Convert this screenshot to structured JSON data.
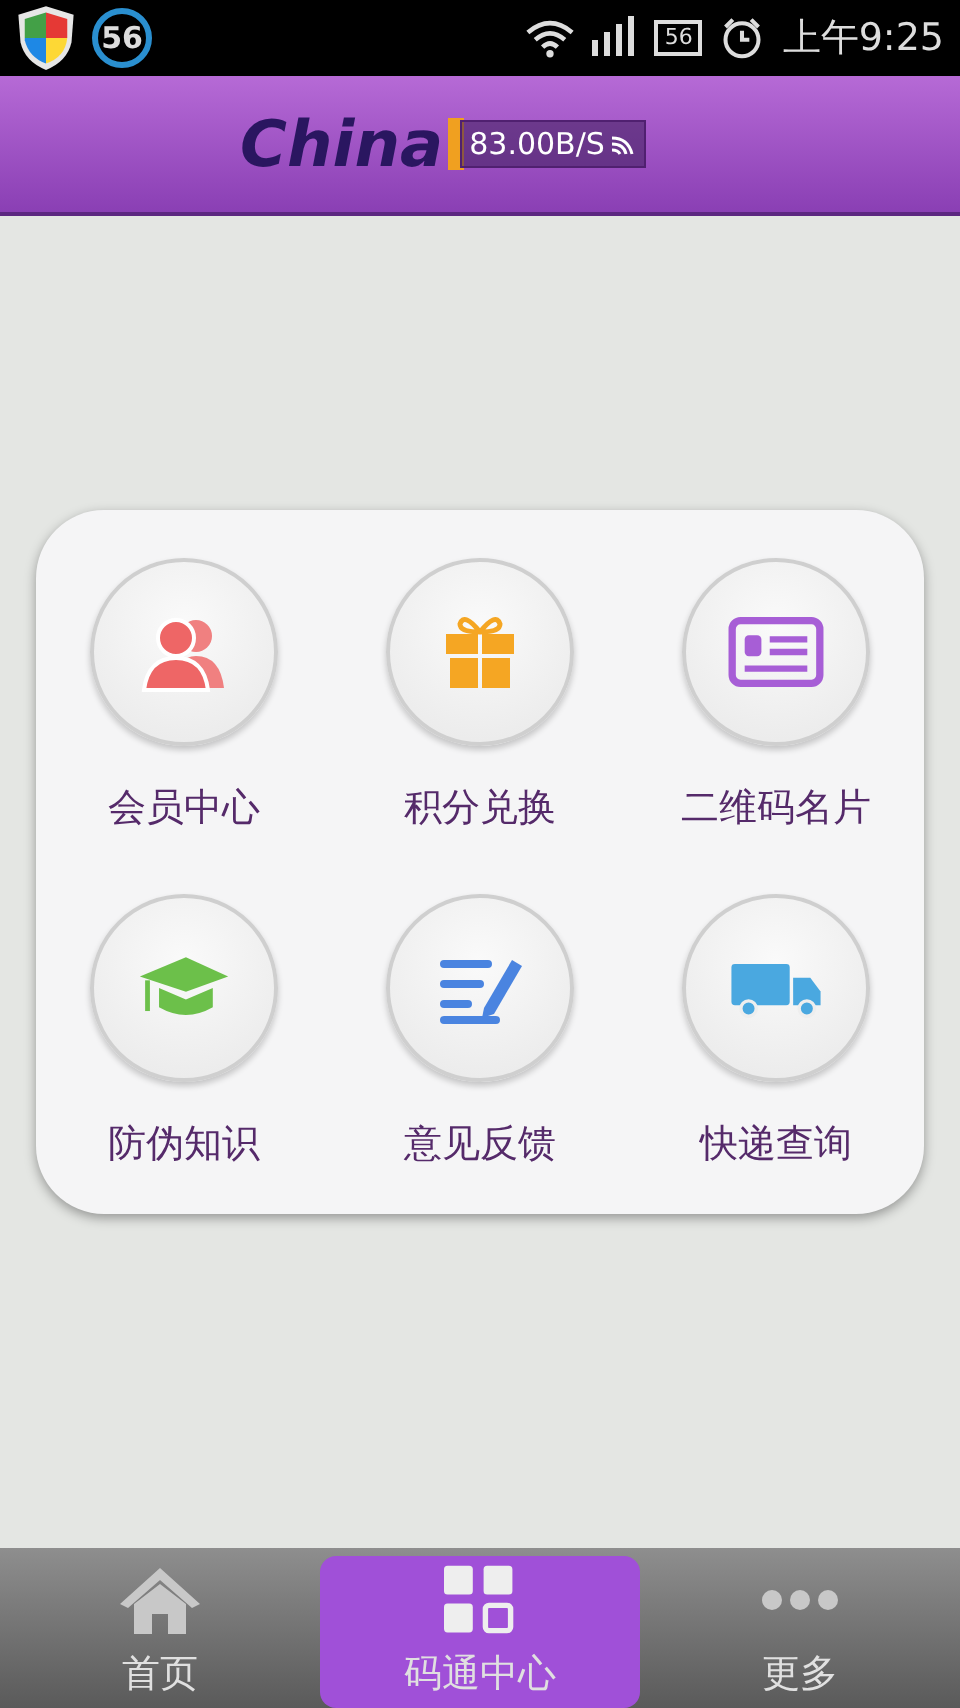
{
  "status_bar": {
    "notification_badge": "56",
    "battery": "56",
    "time": "上午9:25"
  },
  "header": {
    "logo": "China",
    "speed_overlay": "83.00B/S"
  },
  "menu": [
    {
      "label": "会员中心",
      "kind": "members"
    },
    {
      "label": "积分兑换",
      "kind": "gift"
    },
    {
      "label": "二维码名片",
      "kind": "card"
    },
    {
      "label": "防伪知识",
      "kind": "cap"
    },
    {
      "label": "意见反馈",
      "kind": "feedback"
    },
    {
      "label": "快递查询",
      "kind": "truck"
    }
  ],
  "tabs": [
    {
      "label": "首页",
      "kind": "home",
      "selected": false
    },
    {
      "label": "码通中心",
      "kind": "grid",
      "selected": true
    },
    {
      "label": "更多",
      "kind": "more",
      "selected": false
    }
  ]
}
